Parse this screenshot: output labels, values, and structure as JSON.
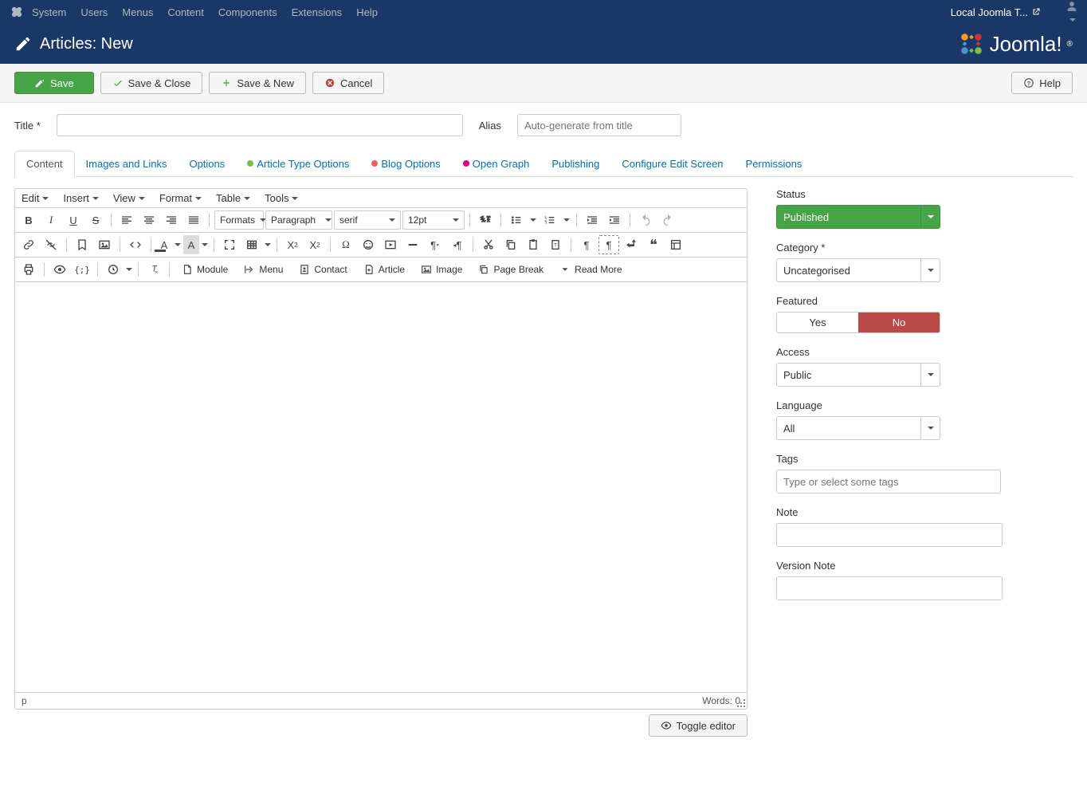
{
  "topnav": {
    "items": [
      "System",
      "Users",
      "Menus",
      "Content",
      "Components",
      "Extensions",
      "Help"
    ],
    "site": "Local Joomla T..."
  },
  "header": {
    "title": "Articles: New",
    "brand": "Joomla!"
  },
  "toolbar": {
    "save": "Save",
    "save_close": "Save & Close",
    "save_new": "Save & New",
    "cancel": "Cancel",
    "help": "Help"
  },
  "fields": {
    "title_label": "Title *",
    "alias_label": "Alias",
    "alias_placeholder": "Auto-generate from title"
  },
  "tabs": [
    "Content",
    "Images and Links",
    "Options",
    "Article Type Options",
    "Blog Options",
    "Open Graph",
    "Publishing",
    "Configure Edit Screen",
    "Permissions"
  ],
  "editor": {
    "menus": [
      "Edit",
      "Insert",
      "View",
      "Format",
      "Table",
      "Tools"
    ],
    "formats_label": "Formats",
    "block_select": "Paragraph",
    "font_select": "serif",
    "size_select": "12pt",
    "insert_buttons": {
      "module": "Module",
      "menu": "Menu",
      "contact": "Contact",
      "article": "Article",
      "image": "Image",
      "page_break": "Page Break",
      "read_more": "Read More"
    },
    "status_path": "p",
    "status_words": "Words: 0",
    "toggle": "Toggle editor"
  },
  "sidebar": {
    "status": {
      "label": "Status",
      "value": "Published"
    },
    "category": {
      "label": "Category *",
      "value": "Uncategorised"
    },
    "featured": {
      "label": "Featured",
      "yes": "Yes",
      "no": "No"
    },
    "access": {
      "label": "Access",
      "value": "Public"
    },
    "language": {
      "label": "Language",
      "value": "All"
    },
    "tags": {
      "label": "Tags",
      "placeholder": "Type or select some tags"
    },
    "note": {
      "label": "Note"
    },
    "version_note": {
      "label": "Version Note"
    }
  }
}
